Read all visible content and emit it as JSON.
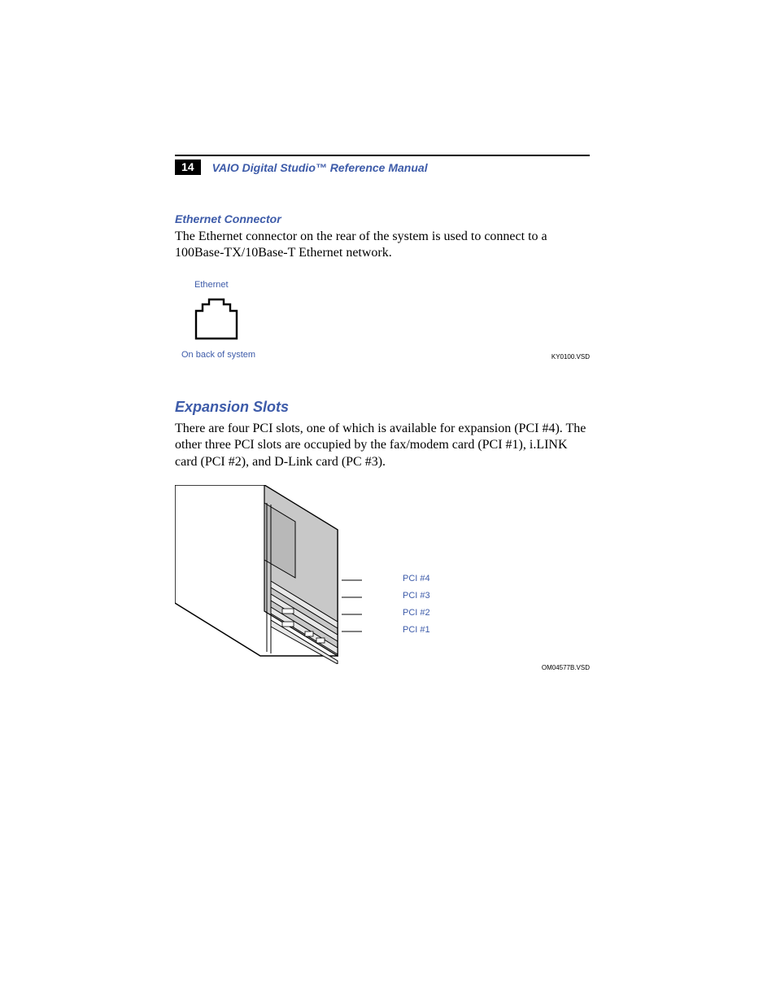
{
  "header": {
    "page_number": "14",
    "manual_title": "VAIO Digital Studio™ Reference Manual"
  },
  "section1": {
    "heading": "Ethernet Connector",
    "body": "The Ethernet connector on the rear of the system is used to connect to a 100Base-TX/10Base-T Ethernet network.",
    "figure": {
      "label_top": "Ethernet",
      "caption": "On back of system",
      "code": "KY0100.VSD"
    }
  },
  "section2": {
    "heading": "Expansion Slots",
    "body": "There are four PCI slots, one of which is available for expansion (PCI #4). The other three PCI slots are occupied by the fax/modem card (PCI #1), i.LINK card (PCI #2), and D-Link card (PC #3).",
    "figure": {
      "labels": [
        "PCI #4",
        "PCI #3",
        "PCI #2",
        "PCI #1"
      ],
      "code": "OM04577B.VSD"
    }
  }
}
